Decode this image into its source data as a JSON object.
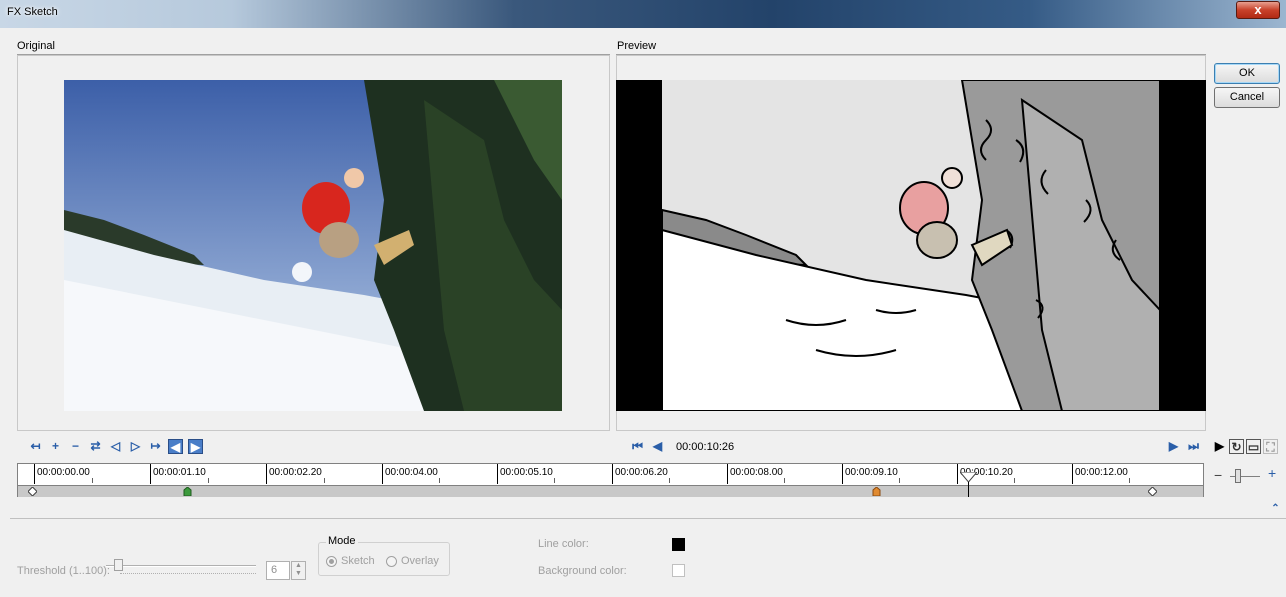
{
  "window": {
    "title": "FX Sketch",
    "close_label": "x"
  },
  "panels": {
    "original_label": "Original",
    "preview_label": "Preview"
  },
  "buttons": {
    "ok": "OK",
    "cancel": "Cancel"
  },
  "preview_controls": {
    "timecode": "00:00:10:26"
  },
  "timeline": {
    "tick_labels": [
      "00:00:00.00",
      "00:00:01.10",
      "00:00:02.20",
      "00:00:04.00",
      "00:00:05.10",
      "00:00:06.20",
      "00:00:08.00",
      "00:00:09.10",
      "00:00:10.20",
      "00:00:12.00"
    ],
    "zoom_minus": "−",
    "zoom_plus": "+"
  },
  "settings": {
    "threshold_label": "Threshold (1..100):",
    "threshold_value": "6",
    "mode_label": "Mode",
    "mode_options": [
      "Sketch",
      "Overlay"
    ],
    "mode_selected": "Sketch",
    "line_color_label": "Line color:",
    "line_color": "#000000",
    "background_color_label": "Background color:",
    "background_color": "#ffffff"
  },
  "icons": {
    "toolbar": [
      "prev-keyframe-icon",
      "add-keyframe-icon",
      "remove-keyframe-icon",
      "reverse-keyframe-icon",
      "step-back-icon",
      "step-forward-icon",
      "next-keyframe-icon",
      "first-keyframe-icon",
      "last-keyframe-icon"
    ],
    "preview": [
      "go-to-start-icon",
      "step-back-frame-icon",
      "step-forward-frame-icon",
      "go-to-end-icon",
      "play-icon",
      "loop-icon",
      "preview-device-icon",
      "fullscreen-icon"
    ]
  }
}
